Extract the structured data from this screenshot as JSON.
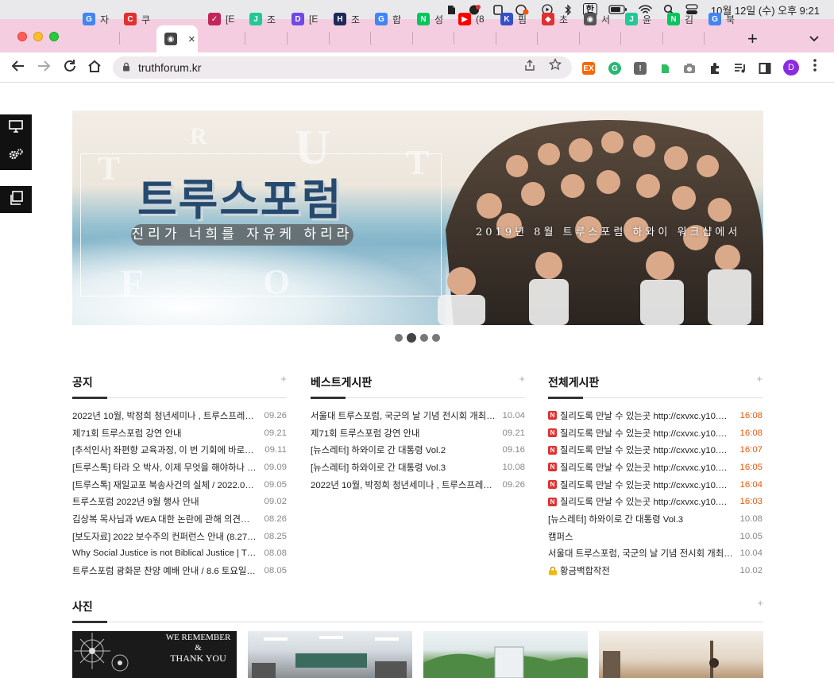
{
  "menubar": {
    "datetime": "10월 12일 (수) 오후  9:21",
    "input_method": "한"
  },
  "tabs": [
    {
      "label": "자",
      "icon": "google-icon",
      "color": "#4285f4",
      "glyph": "G"
    },
    {
      "label": "쿠",
      "icon": "coupang-icon",
      "color": "#e03131",
      "glyph": "C"
    },
    {
      "label": "",
      "icon": "globe-icon",
      "color": "#444444",
      "glyph": "◉",
      "active": true
    },
    {
      "label": "[E",
      "icon": "check-icon",
      "color": "#c2255c",
      "glyph": "✓"
    },
    {
      "label": "조",
      "icon": "jo-icon",
      "color": "#20c997",
      "glyph": "J"
    },
    {
      "label": "[E",
      "icon": "d-icon",
      "color": "#7048e8",
      "glyph": "D"
    },
    {
      "label": "조",
      "icon": "h-icon",
      "color": "#1c2a5a",
      "glyph": "H"
    },
    {
      "label": "합",
      "icon": "google-icon",
      "color": "#4285f4",
      "glyph": "G"
    },
    {
      "label": "성",
      "icon": "naver-icon",
      "color": "#03c75a",
      "glyph": "N"
    },
    {
      "label": "(8",
      "icon": "youtube-icon",
      "color": "#ff0000",
      "glyph": "▶"
    },
    {
      "label": "핌",
      "icon": "k-icon",
      "color": "#364fc7",
      "glyph": "K"
    },
    {
      "label": "초",
      "icon": "shield-icon",
      "color": "#e03131",
      "glyph": "◆"
    },
    {
      "label": "서",
      "icon": "globe-icon",
      "color": "#555555",
      "glyph": "◉"
    },
    {
      "label": "윤",
      "icon": "jo-icon",
      "color": "#20c997",
      "glyph": "J"
    },
    {
      "label": "김",
      "icon": "naver-icon",
      "color": "#03c75a",
      "glyph": "N"
    },
    {
      "label": "북",
      "icon": "google-icon",
      "color": "#4285f4",
      "glyph": "G"
    }
  ],
  "url": "truthforum.kr",
  "banner": {
    "title": "트루스포럼",
    "slogan": "진리가 너희를 자유케 하리라",
    "caption": "2019년 8월 트루스포럼 하와이 워크샵에서",
    "slides": 4,
    "active_slide": 2
  },
  "boards": [
    {
      "title": "공지",
      "items": [
        {
          "text": "2022년 10월, 박정희 청년세미나 , 트루스프레…",
          "date": "09.26"
        },
        {
          "text": "제71회 트루스포럼 강연 안내",
          "date": "09.21"
        },
        {
          "text": "[추석인사] 좌편향 교육과정, 이 번 기회에 바로…",
          "date": "09.11"
        },
        {
          "text": "[트루스톡] 타라 오 박사, 이제 무엇을 해야하나 …",
          "date": "09.09"
        },
        {
          "text": "[트루스톡] 재일교포 북송사건의 실체 / 2022.0…",
          "date": "09.05"
        },
        {
          "text": "트루스포럼 2022년 9월 행사 안내",
          "date": "09.02"
        },
        {
          "text": "김상복 목사님과 WEA 대한 논란에 관해 의견을…",
          "date": "08.26"
        },
        {
          "text": "[보도자료] 2022 보수주의 컨퍼런스 안내 (8.27 …",
          "date": "08.25"
        },
        {
          "text": "Why Social Justice is not Biblical Justice | T…",
          "date": "08.08"
        },
        {
          "text": "트루스포럼 광화문 찬양 예배 안내 / 8.6 토요일 …",
          "date": "08.05"
        }
      ]
    },
    {
      "title": "베스트게시판",
      "items": [
        {
          "text": "서울대 트루스포럼, 국군의 날 기념 전시회 개최,…",
          "date": "10.04"
        },
        {
          "text": "제71회 트루스포럼 강연 안내",
          "date": "09.21"
        },
        {
          "text": "[뉴스레터] 하와이로 간 대통령 Vol.2",
          "date": "09.16"
        },
        {
          "text": "[뉴스레터] 하와이로 간 대통령 Vol.3",
          "date": "10.08"
        },
        {
          "text": "2022년 10월, 박정희 청년세미나 , 트루스프레…",
          "date": "09.26"
        }
      ]
    },
    {
      "title": "전체게시판",
      "items": [
        {
          "text": "질리도록 만날 수 있는곳 http://cxvxc.y10.…",
          "date": "16:08",
          "badge": "N",
          "new": true
        },
        {
          "text": "질리도록 만날 수 있는곳 http://cxvxc.y10.…",
          "date": "16:08",
          "badge": "N",
          "new": true
        },
        {
          "text": "질리도록 만날 수 있는곳 http://cxvxc.y10.…",
          "date": "16:07",
          "badge": "N",
          "new": true
        },
        {
          "text": "질리도록 만날 수 있는곳 http://cxvxc.y10.…",
          "date": "16:05",
          "badge": "N",
          "new": true
        },
        {
          "text": "질리도록 만날 수 있는곳 http://cxvxc.y10.…",
          "date": "16:04",
          "badge": "N",
          "new": true
        },
        {
          "text": "질리도록 만날 수 있는곳 http://cxvxc.y10.…",
          "date": "16:03",
          "badge": "N",
          "new": true
        },
        {
          "text": "[뉴스레터] 하와이로 간 대통령 Vol.3",
          "date": "10.08"
        },
        {
          "text": "캠퍼스",
          "date": "10.05"
        },
        {
          "text": "서울대 트루스포럼, 국군의 날 기념 전시회 개최,…",
          "date": "10.04"
        },
        {
          "text": "황금백합작전",
          "date": "10.02",
          "lock": true
        }
      ]
    }
  ],
  "photos": {
    "title": "사진",
    "thumb1_text": [
      "WE REMEMBER",
      "&",
      "THANK YOU"
    ]
  },
  "colors": {
    "tabstrip": "#f4cde0",
    "accent_new": "#e8590c",
    "badge": "#e03131",
    "title_blue": "#264a6e"
  }
}
